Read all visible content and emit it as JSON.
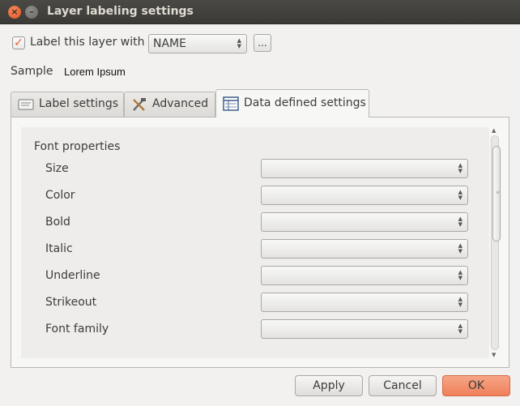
{
  "window": {
    "title": "Layer labeling settings",
    "close_glyph": "×",
    "minimize_glyph": "–"
  },
  "label_row": {
    "checkbox_checked": true,
    "checkbox_glyph": "✓",
    "label": "Label this layer with",
    "field_value": "NAME",
    "expression_button": "..."
  },
  "sample": {
    "label": "Sample",
    "text": "Lorem Ipsum"
  },
  "tabs": [
    {
      "label": "Label settings",
      "icon": "label-settings-icon",
      "active": false
    },
    {
      "label": "Advanced",
      "icon": "tools-icon",
      "active": false
    },
    {
      "label": "Data defined settings",
      "icon": "table-icon",
      "active": true
    }
  ],
  "panel": {
    "section_title": "Font properties",
    "properties": [
      {
        "label": "Size",
        "value": ""
      },
      {
        "label": "Color",
        "value": ""
      },
      {
        "label": "Bold",
        "value": ""
      },
      {
        "label": "Italic",
        "value": ""
      },
      {
        "label": "Underline",
        "value": ""
      },
      {
        "label": "Strikeout",
        "value": ""
      },
      {
        "label": "Font family",
        "value": ""
      }
    ]
  },
  "buttons": {
    "apply": "Apply",
    "cancel": "Cancel",
    "ok": "OK"
  },
  "colors": {
    "accent": "#e8602c",
    "ok_button": "#f08e6b",
    "titlebar": "#3c3b37"
  }
}
